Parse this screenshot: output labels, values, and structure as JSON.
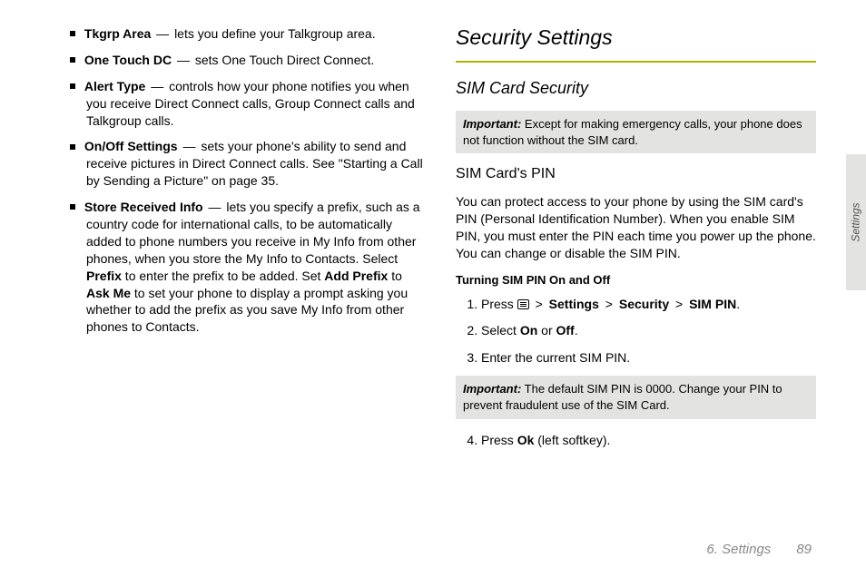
{
  "left": {
    "bullets": [
      {
        "term": "Tkgrp Area",
        "dash": "—",
        "text": "lets you define your Talkgroup area."
      },
      {
        "term": "One Touch DC",
        "dash": "—",
        "text": "sets One Touch Direct Connect."
      },
      {
        "term": "Alert Type",
        "dash": "—",
        "text": "controls how your phone notifies you when you receive Direct Connect calls, Group Connect calls and Talkgroup calls."
      },
      {
        "term": "On/Off Settings",
        "dash": "—",
        "rich": true,
        "text_a": "sets your phone's ability to send and receive pictures in Direct Connect calls. See \"Starting a Call by Sending a Picture\" on page 35."
      },
      {
        "term": "Store Received Info",
        "dash": "—",
        "rich": true,
        "text_b1": "lets you specify a prefix, such as a country code for international calls, to be automatically added to phone numbers you receive in My Info from other phones, when you store the My Info to Contacts. Select ",
        "bold1": "Prefix",
        "text_b2": " to enter the prefix to be added. Set ",
        "bold2": "Add Prefix",
        "text_b3": " to ",
        "bold3": "Ask Me",
        "text_b4": " to set your phone to display a prompt asking you whether to add the prefix as you save My Info from other phones to Contacts."
      }
    ]
  },
  "right": {
    "h2": "Security Settings",
    "h3": "SIM Card Security",
    "note1_label": "Important:",
    "note1_text": "Except for making emergency calls, your phone does not function without the SIM card.",
    "h4": "SIM Card's PIN",
    "para1": "You can protect access to your phone by using the SIM card's PIN (Personal Identification Number). When you enable SIM PIN, you must enter the PIN each time you power up the phone. You can change or disable the SIM PIN.",
    "h5": "Turning SIM PIN On and Off",
    "step1_a": "Press ",
    "step1_sep": ">",
    "step1_b": "Settings",
    "step1_c": "Security",
    "step1_d": "SIM PIN",
    "step1_e": ".",
    "step2_a": "Select ",
    "step2_b": "On",
    "step2_c": " or ",
    "step2_d": "Off",
    "step2_e": ".",
    "step3": "Enter the current SIM PIN.",
    "note2_label": "Important:",
    "note2_text": "The default SIM PIN is 0000. Change your PIN to prevent fraudulent use of the SIM Card.",
    "step4_a": "Press ",
    "step4_b": "Ok",
    "step4_c": " (left softkey)."
  },
  "sideTab": "Settings",
  "footer": {
    "section": "6. Settings",
    "page": "89"
  }
}
